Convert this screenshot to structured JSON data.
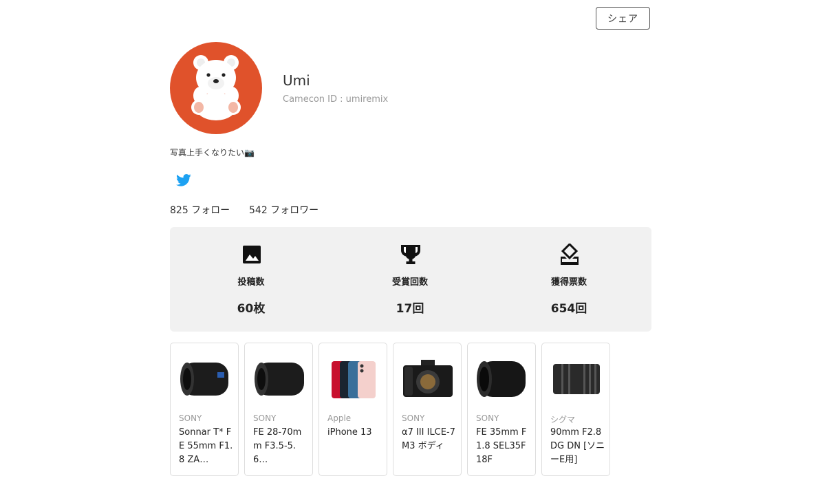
{
  "header": {
    "share_label": "シェア"
  },
  "profile": {
    "name": "Umi",
    "camecon_id": "Camecon ID : umiremix",
    "bio": "写真上手くなりたい📷",
    "following": "825 フォロー",
    "followers": "542 フォロワー"
  },
  "stats": [
    {
      "icon": "image-icon",
      "label": "投稿数",
      "value": "60枚"
    },
    {
      "icon": "trophy-icon",
      "label": "受賞回数",
      "value": "17回"
    },
    {
      "icon": "vote-ballot-icon",
      "label": "獲得票数",
      "value": "654回"
    }
  ],
  "gear": [
    {
      "brand": "SONY",
      "name": "Sonnar T* FE 55mm F1.8 ZA…"
    },
    {
      "brand": "SONY",
      "name": "FE 28-70mm F3.5-5.6…"
    },
    {
      "brand": "Apple",
      "name": "iPhone 13"
    },
    {
      "brand": "SONY",
      "name": "α7 III ILCE-7M3 ボディ"
    },
    {
      "brand": "SONY",
      "name": "FE 35mm F1.8 SEL35F18F"
    },
    {
      "brand": "シグマ",
      "name": "90mm F2.8 DG DN [ソニーE用]"
    }
  ],
  "colors": {
    "avatar_bg": "#e0522b",
    "twitter": "#1da1f2",
    "panel_bg": "#f1f1f1"
  }
}
